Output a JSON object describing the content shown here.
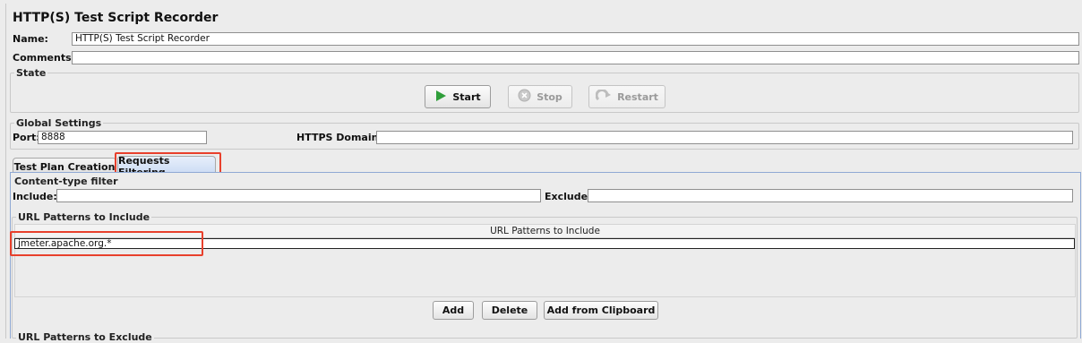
{
  "title": "HTTP(S) Test Script Recorder",
  "name": {
    "label": "Name:",
    "value": "HTTP(S) Test Script Recorder"
  },
  "comments": {
    "label": "Comments:",
    "value": ""
  },
  "state": {
    "title": "State",
    "start_label": "Start",
    "stop_label": "Stop",
    "restart_label": "Restart"
  },
  "global_settings": {
    "title": "Global Settings",
    "port_label": "Port:",
    "port_value": "8888",
    "https_domains_label": "HTTPS Domains:",
    "https_domains_value": ""
  },
  "tabs": [
    {
      "label": "Test Plan Creation",
      "active": false
    },
    {
      "label": "Requests Filtering",
      "active": true
    }
  ],
  "content_type_filter": {
    "title": "Content-type filter",
    "include_label": "Include:",
    "include_value": "",
    "exclude_label": "Exclude:",
    "exclude_value": ""
  },
  "url_include": {
    "title": "URL Patterns to Include",
    "column_header": "URL Patterns to Include",
    "rows": [
      "jmeter.apache.org.*"
    ],
    "add_label": "Add",
    "delete_label": "Delete",
    "add_clipboard_label": "Add from Clipboard"
  },
  "url_exclude": {
    "title": "URL Patterns to Exclude"
  },
  "colors": {
    "highlight": "#e8402c",
    "start_icon": "#2f9e3a",
    "active_tab": "#c9d9f3"
  }
}
